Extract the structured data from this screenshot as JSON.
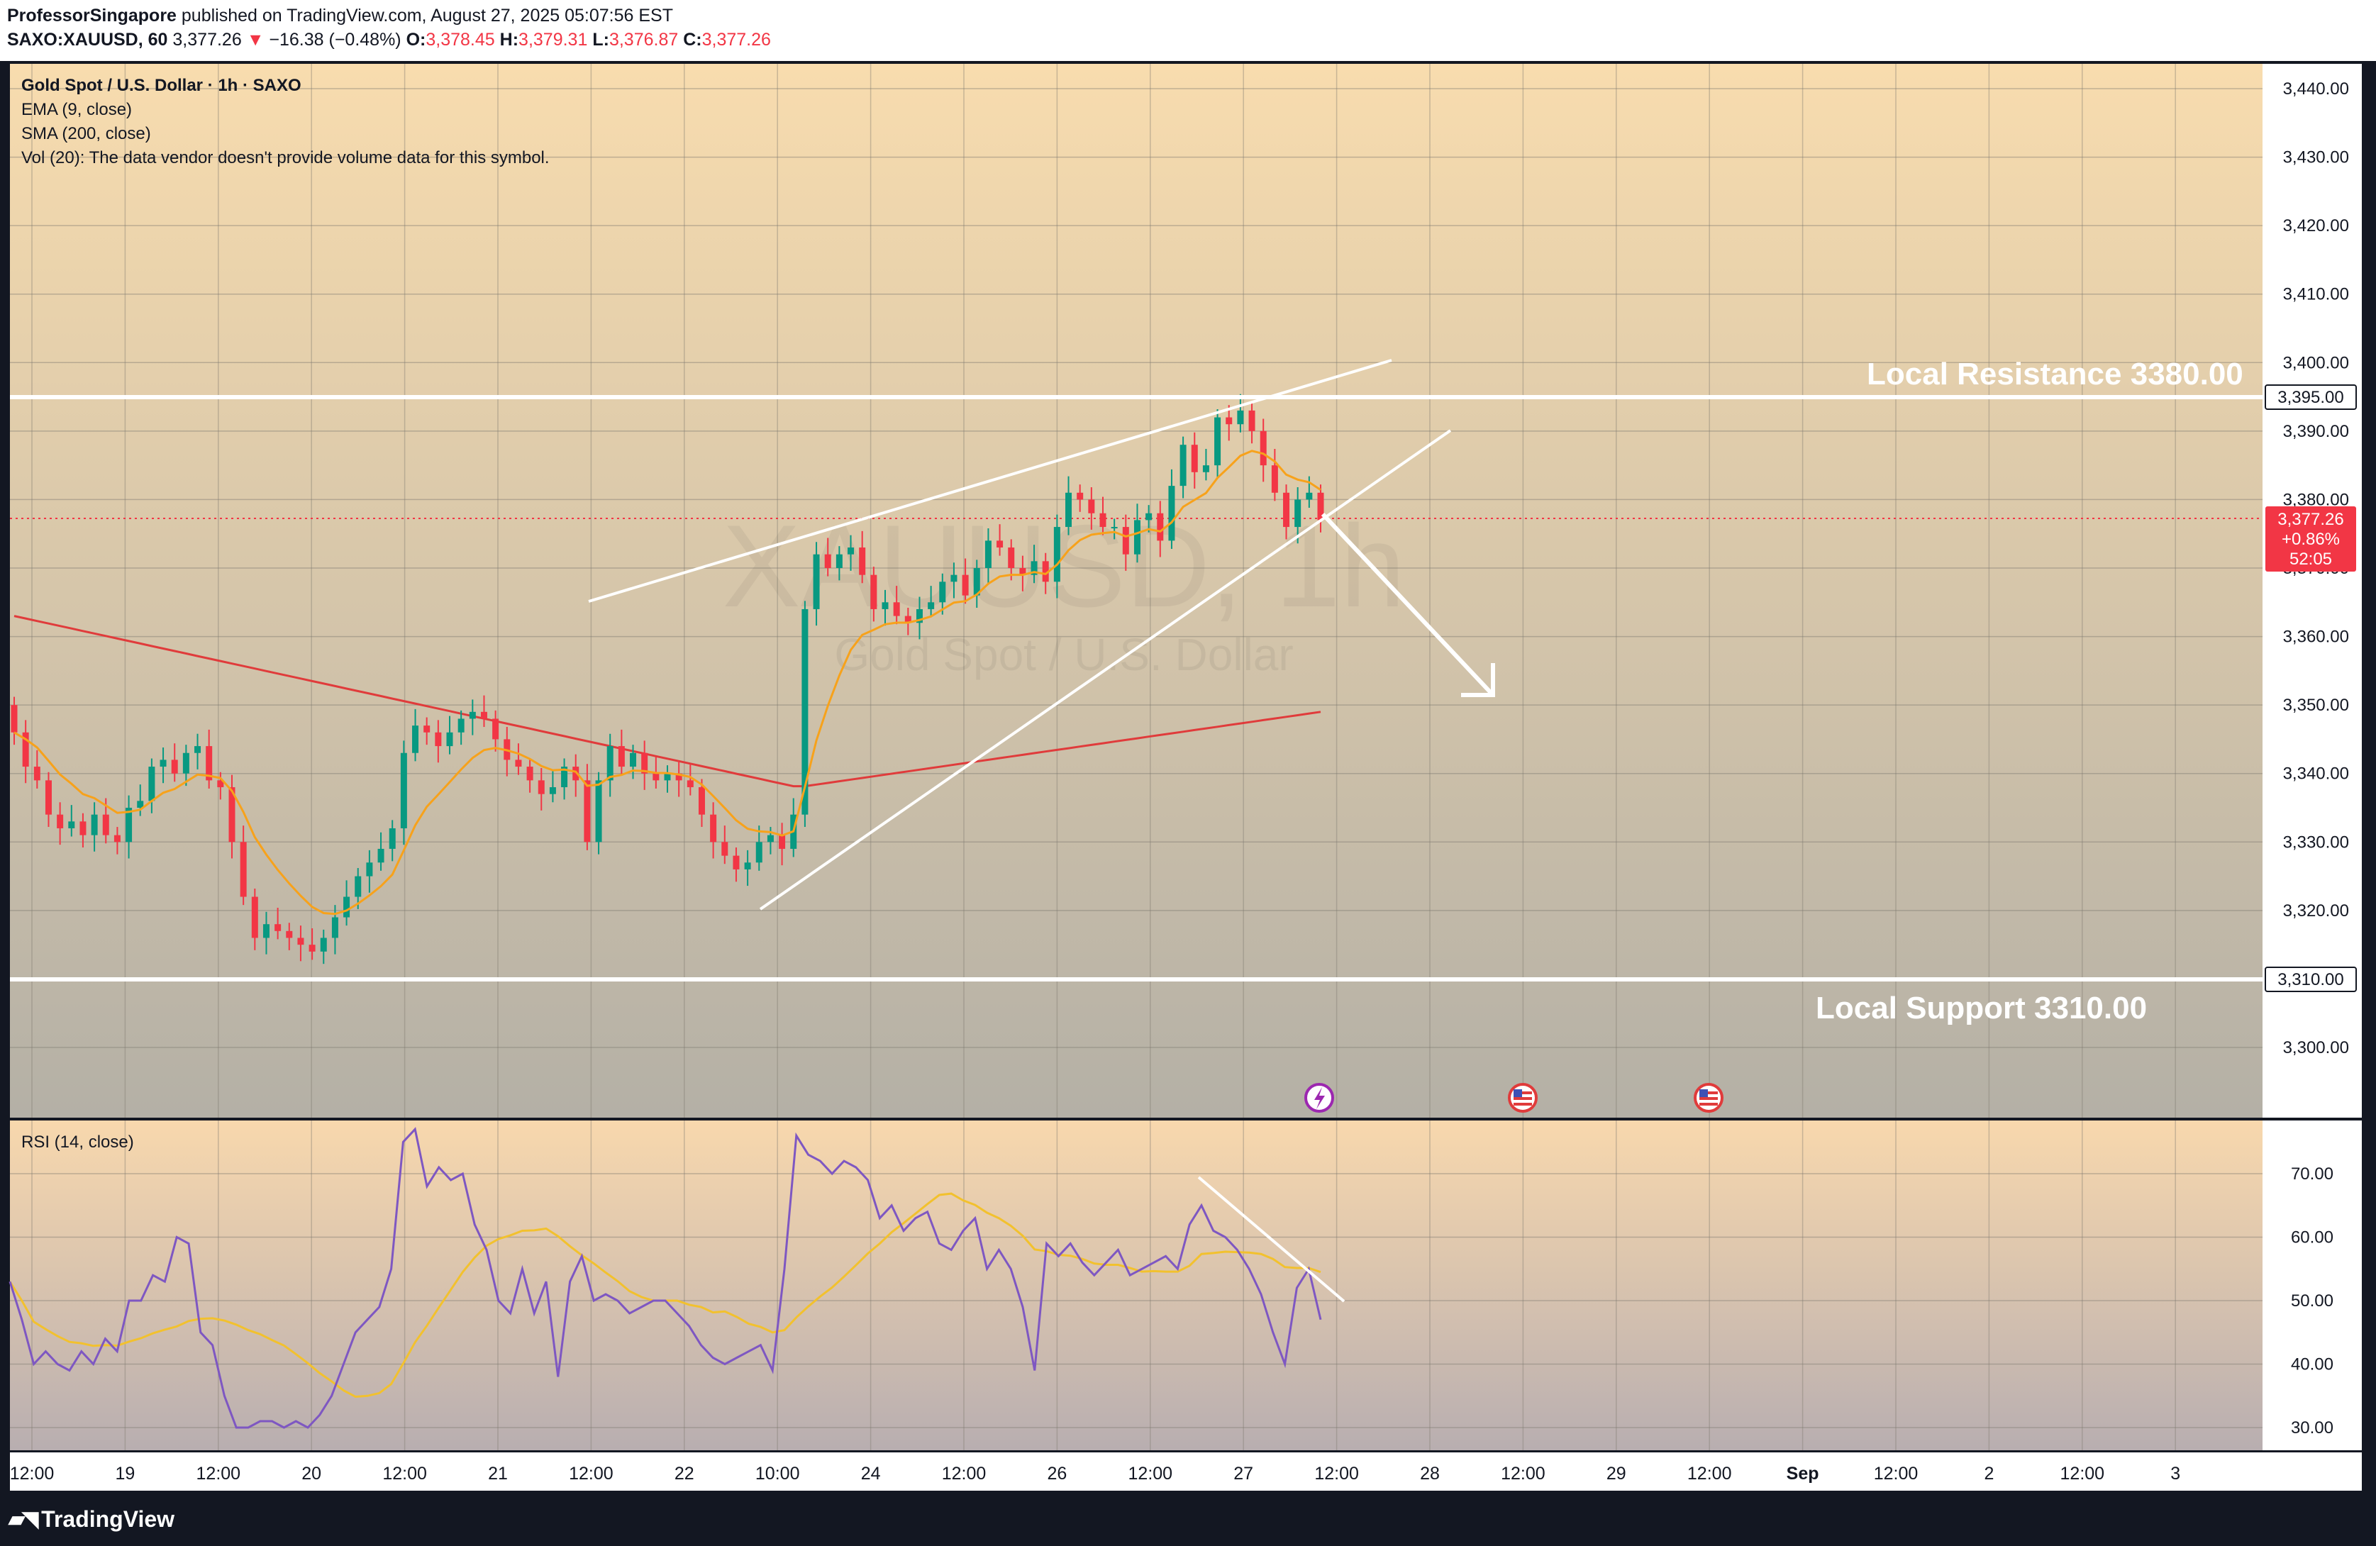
{
  "header": {
    "author": "ProfessorSingapore",
    "published_text": "published on TradingView.com, August 27, 2025 05:07:56 EST",
    "symbol": "SAXO:XAUUSD, 60",
    "last": "3,377.26",
    "change_arrow": "▼",
    "change": "−16.38 (−0.48%)",
    "o_label": "O:",
    "o_value": "3,378.45",
    "h_label": "H:",
    "h_value": "3,379.31",
    "l_label": "L:",
    "l_value": "3,376.87",
    "c_label": "C:",
    "c_value": "3,377.26"
  },
  "legend": {
    "title": "Gold Spot / U.S. Dollar · 1h · SAXO",
    "ema": "EMA (9, close)",
    "sma": "SMA (200, close)",
    "vol": "Vol (20): The data vendor doesn't provide volume data for this symbol."
  },
  "watermark": {
    "symbol": "XAUUSD, 1h",
    "name": "Gold Spot / U.S. Dollar"
  },
  "annotations": {
    "resistance_label": "Local Resistance 3380.00",
    "support_label": "Local Support 3310.00",
    "resistance_tag": "3,395.00",
    "support_tag": "3,310.00"
  },
  "price_tag": {
    "price": "3,377.26",
    "change": "+0.86%",
    "countdown": "52:05",
    "color": "#f23645"
  },
  "rsi": {
    "title": "RSI (14, close)",
    "ticks": [
      "70.00",
      "60.00",
      "50.00",
      "40.00",
      "30.00"
    ]
  },
  "footer": {
    "brand": "TradingView",
    "logo_icon": "tradingview-logo-icon"
  },
  "event_icons": [
    "lightning-event-icon",
    "us-flag-icon",
    "us-flag-icon"
  ],
  "colors": {
    "up": "#089981",
    "down": "#f23645",
    "ema": "#f7a21b",
    "sma": "#e03b3b",
    "rsi": "#7e57c2",
    "rsi_ma": "#f2c12e",
    "bg_top": "#f8dcae",
    "bg_bottom": "#b4b0a6"
  },
  "chart_data": {
    "type": "candlestick",
    "timeframe": "1h",
    "price_axis": {
      "ticks": [
        "3,440.00",
        "3,430.00",
        "3,420.00",
        "3,410.00",
        "3,400.00",
        "3,390.00",
        "3,380.00",
        "3,370.00",
        "3,360.00",
        "3,350.00",
        "3,340.00",
        "3,330.00",
        "3,320.00",
        "3,310.00",
        "3,300.00"
      ],
      "range": [
        3295,
        3444
      ]
    },
    "time_axis": {
      "labels": [
        "12:00",
        "19",
        "12:00",
        "20",
        "12:00",
        "21",
        "12:00",
        "22",
        "10:00",
        "24",
        "12:00",
        "26",
        "12:00",
        "27",
        "12:00",
        "28",
        "12:00",
        "29",
        "12:00",
        "Sep",
        "12:00",
        "2",
        "12:00",
        "3"
      ]
    },
    "close_series": [
      3346,
      3341,
      3339,
      3334,
      3332,
      3333,
      3331,
      3334,
      3331,
      3330,
      3335,
      3336,
      3341,
      3342,
      3340,
      3343,
      3344,
      3339,
      3338,
      3330,
      3322,
      3316,
      3318,
      3317,
      3316,
      3315,
      3314,
      3316,
      3319,
      3322,
      3325,
      3327,
      3329,
      3332,
      3343,
      3347,
      3346,
      3344,
      3346,
      3348,
      3349,
      3348,
      3345,
      3342,
      3341,
      3339,
      3337,
      3338,
      3341,
      3339,
      3330,
      3339,
      3344,
      3341,
      3343,
      3340,
      3339,
      3340,
      3339,
      3338,
      3334,
      3330,
      3328,
      3326,
      3327,
      3330,
      3331,
      3329,
      3334,
      3364,
      3372,
      3370,
      3372,
      3373,
      3369,
      3364,
      3365,
      3363,
      3362,
      3364,
      3365,
      3368,
      3369,
      3366,
      3370,
      3374,
      3373,
      3370,
      3369,
      3371,
      3368,
      3376,
      3381,
      3380,
      3378,
      3376,
      3376,
      3372,
      3377,
      3378,
      3374,
      3382,
      3388,
      3384,
      3385,
      3392,
      3391,
      3393,
      3390,
      3385,
      3381,
      3376,
      3380,
      3381,
      3377
    ],
    "ema_9": "plotted",
    "sma_200": "plotted",
    "levels": [
      {
        "name": "Local Resistance",
        "label_value": 3380.0,
        "drawn_at": 3395.0
      },
      {
        "name": "Local Support",
        "label_value": 3310.0,
        "drawn_at": 3310.0
      }
    ],
    "pattern": "rising wedge with projected downward arrow",
    "rsi_14": {
      "range": [
        27,
        79
      ],
      "values": [
        53,
        47,
        40,
        42,
        40,
        39,
        42,
        40,
        44,
        42,
        50,
        50,
        54,
        53,
        60,
        59,
        45,
        43,
        35,
        30,
        30,
        31,
        31,
        30,
        31,
        30,
        32,
        35,
        40,
        45,
        47,
        49,
        55,
        75,
        77,
        68,
        71,
        69,
        70,
        62,
        58,
        50,
        48,
        55,
        48,
        53,
        38,
        53,
        57,
        50,
        51,
        50,
        48,
        49,
        50,
        50,
        48,
        46,
        43,
        41,
        40,
        41,
        42,
        43,
        39,
        55,
        76,
        73,
        72,
        70,
        72,
        71,
        69,
        63,
        65,
        61,
        63,
        64,
        59,
        58,
        61,
        63,
        55,
        58,
        55,
        49,
        39,
        59,
        57,
        59,
        56,
        54,
        56,
        58,
        54,
        55,
        56,
        57,
        55,
        62,
        65,
        61,
        60,
        58,
        55,
        51,
        45,
        40,
        52,
        55,
        47
      ],
      "overbought": 70,
      "oversold": 30
    }
  }
}
